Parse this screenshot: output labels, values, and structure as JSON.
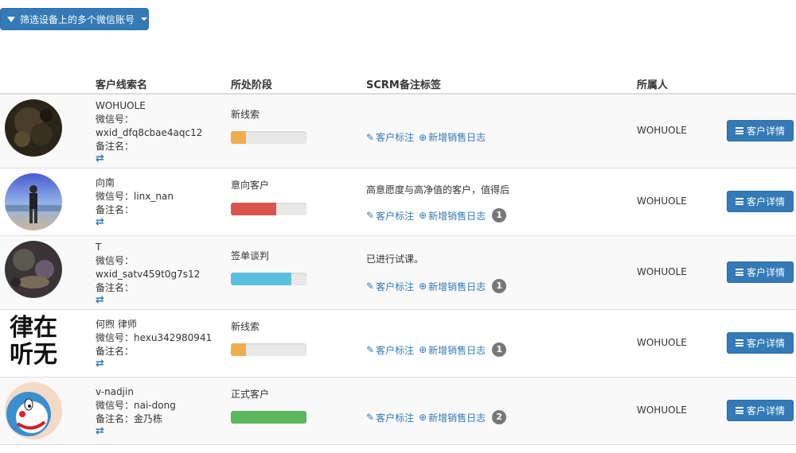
{
  "toolbar": {
    "filter_label": "筛选设备上的多个微信账号"
  },
  "table": {
    "headers": {
      "name": "客户线索名",
      "stage": "所处阶段",
      "scrm": "SCRM备注标签",
      "owner": "所属人"
    },
    "rows": [
      {
        "name": "WOHUOLE",
        "wechat_label": "微信号：",
        "wechat_id": "wxid_dfq8cbae4aqc12",
        "remark_label": "备注名：",
        "remark": "",
        "stage": "新线索",
        "progress": 0.2,
        "progress_color": "#f0ad4e",
        "note": "",
        "tag_link": "客户标注",
        "log_link": "新增销售日志",
        "log_count": "",
        "owner": "WOHUOLE",
        "detail": "客户详情"
      },
      {
        "name": "向南",
        "wechat_label": "微信号：",
        "wechat_id": "linx_nan",
        "remark_label": "备注名：",
        "remark": "",
        "stage": "意向客户",
        "progress": 0.6,
        "progress_color": "#d9534f",
        "note": "高意愿度与高净值的客户，值得后",
        "tag_link": "客户标注",
        "log_link": "新增销售日志",
        "log_count": "1",
        "owner": "WOHUOLE",
        "detail": "客户详情"
      },
      {
        "name": "T",
        "wechat_label": "微信号：",
        "wechat_id": "wxid_satv459t0g7s12",
        "remark_label": "备注名：",
        "remark": "",
        "stage": "签单谈判",
        "progress": 0.8,
        "progress_color": "#5bc0de",
        "note": "已进行试课。",
        "tag_link": "客户标注",
        "log_link": "新增销售日志",
        "log_count": "1",
        "owner": "WOHUOLE",
        "detail": "客户详情"
      },
      {
        "name": "何煦 律师",
        "wechat_label": "微信号：",
        "wechat_id": "hexu342980941",
        "remark_label": "备注名：",
        "remark": "",
        "stage": "新线索",
        "progress": 0.2,
        "progress_color": "#f0ad4e",
        "note": "",
        "tag_link": "客户标注",
        "log_link": "新增销售日志",
        "log_count": "1",
        "owner": "WOHUOLE",
        "detail": "客户详情"
      },
      {
        "name": "v-nadjin",
        "wechat_label": "微信号：",
        "wechat_id": "nai-dong",
        "remark_label": "备注名：",
        "remark": "金乃栋",
        "stage": "正式客户",
        "progress": 1.0,
        "progress_color": "#5cb85c",
        "note": "",
        "tag_link": "客户标注",
        "log_link": "新增销售日志",
        "log_count": "2",
        "owner": "WOHUOLE",
        "detail": "客户详情"
      }
    ]
  },
  "avatar_text": {
    "row4_line1": "律在",
    "row4_line2": "听无"
  }
}
